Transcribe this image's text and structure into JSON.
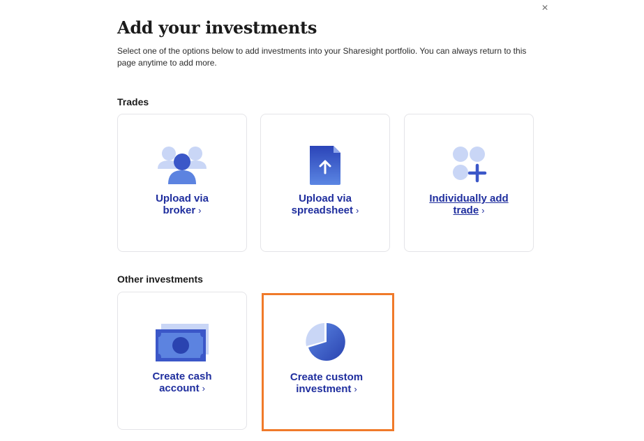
{
  "dialog": {
    "close_icon": "close-icon",
    "title": "Add your investments",
    "intro": "Select one of the options below to add investments into your Sharesight portfolio. You can always return to this page anytime to add more."
  },
  "sections": {
    "trades": {
      "title": "Trades",
      "cards": [
        {
          "line1": "Upload via",
          "line2": "broker",
          "icon": "people-icon"
        },
        {
          "line1": "Upload via",
          "line2": "spreadsheet",
          "icon": "upload-file-icon"
        },
        {
          "line1": "Individually add",
          "line2": "trade",
          "icon": "add-grid-icon"
        }
      ]
    },
    "other": {
      "title": "Other investments",
      "cards": [
        {
          "line1": "Create cash",
          "line2": "account",
          "icon": "cash-icon"
        },
        {
          "line1": "Create custom",
          "line2": "investment",
          "icon": "pie-chart-icon"
        }
      ]
    }
  },
  "colors": {
    "link": "#1f2e9e",
    "icon_dark": "#3b57c8",
    "icon_light": "#c9d6f6",
    "highlight": "#f07a2a"
  },
  "chevron": "›",
  "close_glyph": "×"
}
